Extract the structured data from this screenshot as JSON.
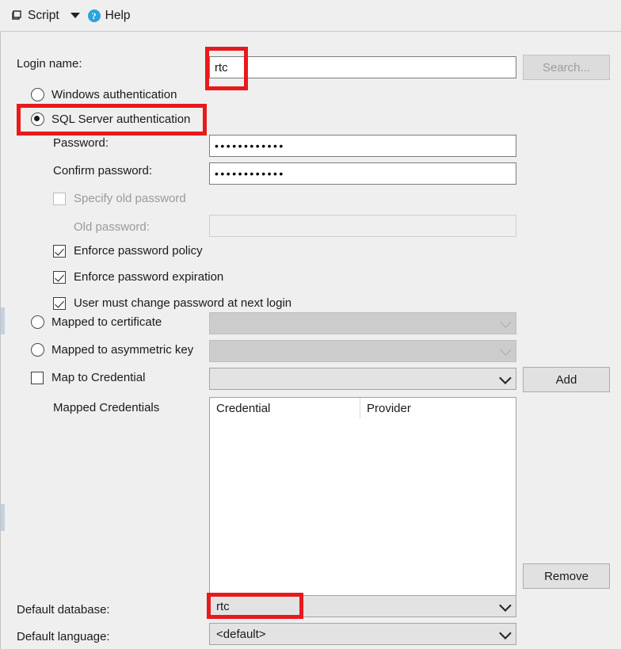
{
  "toolbar": {
    "script_label": "Script",
    "script_icon": "script-icon",
    "dropdown_icon": "chevron-down-icon",
    "help_label": "Help",
    "help_icon": "help-circle-icon"
  },
  "form": {
    "login_name_label": "Login name:",
    "login_name_value": "rtc",
    "search_button": "Search...",
    "windows_auth_label": "Windows authentication",
    "sql_auth_label": "SQL Server authentication",
    "password_label": "Password:",
    "password_value": "••••••••••••",
    "confirm_password_label": "Confirm password:",
    "confirm_password_value": "••••••••••••",
    "specify_old_password_label": "Specify old password",
    "old_password_label": "Old password:",
    "old_password_value": "",
    "enforce_policy_label": "Enforce password policy",
    "enforce_expiration_label": "Enforce password expiration",
    "must_change_label": "User must change password at next login",
    "mapped_certificate_label": "Mapped to certificate",
    "mapped_certificate_value": "",
    "mapped_asymmetric_label": "Mapped to asymmetric key",
    "mapped_asymmetric_value": "",
    "map_credential_label": "Map to Credential",
    "map_credential_value": "",
    "add_button": "Add",
    "remove_button": "Remove",
    "mapped_credentials_label": "Mapped Credentials",
    "credentials_columns": [
      "Credential",
      "Provider"
    ],
    "credentials_rows": [],
    "default_database_label": "Default database:",
    "default_database_value": "rtc",
    "default_language_label": "Default language:",
    "default_language_value": "<default>"
  },
  "selection": {
    "authentication_mode": "sql",
    "enforce_policy_checked": true,
    "enforce_expiration_checked": true,
    "must_change_checked": true,
    "specify_old_password_checked": false,
    "map_credential_checked": false
  },
  "annotations": {
    "color": "#e8191c",
    "boxes": [
      "login-name-value",
      "sql-server-authentication",
      "default-database-value"
    ]
  }
}
